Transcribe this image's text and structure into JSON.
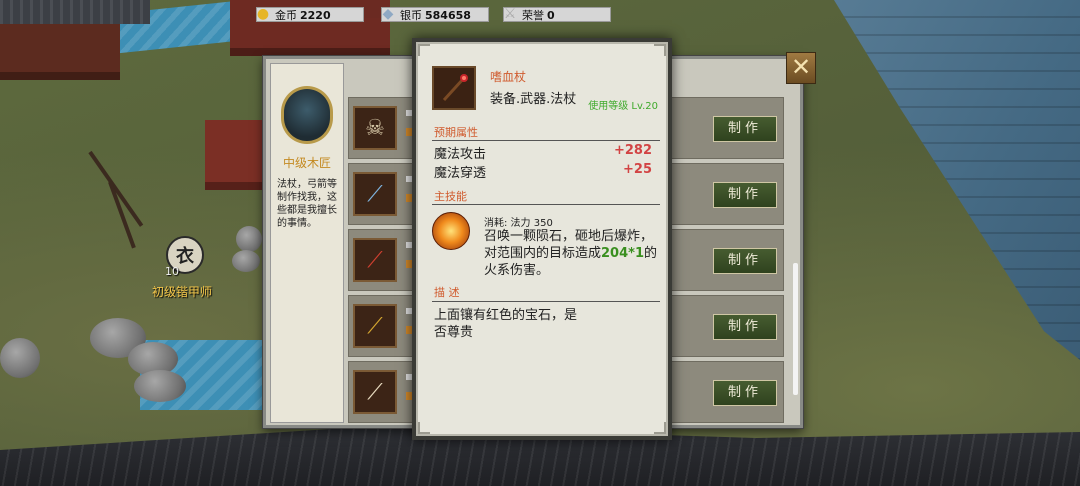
{
  "currency": {
    "gold_label": "金币",
    "gold_value": "2220",
    "silver_label": "银币",
    "silver_value": "584658",
    "honor_label": "荣誉",
    "honor_value": "0"
  },
  "npc": {
    "badge": "衣",
    "level": "10",
    "name": "初级锴甲师"
  },
  "craftsman": {
    "title": "中级木匠",
    "description": "法杖，弓箭等\n制作找我，这\n些都是我擅长\n的事情。"
  },
  "craft_list": {
    "button_label": "制作",
    "items": [
      {
        "icon": "skull-book-icon"
      },
      {
        "icon": "blue-orb-staff-icon"
      },
      {
        "icon": "red-gem-staff-icon"
      },
      {
        "icon": "golden-staff-icon"
      },
      {
        "icon": "scroll-staff-icon"
      }
    ]
  },
  "item_detail": {
    "name": "嗜血杖",
    "type": "装备.武器.法杖",
    "required_level": "使用等级 Lv.20",
    "attributes_title": "预期属性",
    "attributes": [
      {
        "name": "魔法攻击",
        "value": "+282"
      },
      {
        "name": "魔法穿透",
        "value": "+25"
      }
    ],
    "skill_title": "主技能",
    "skill_cost": "消耗: 法力 350",
    "skill_desc_part1": "召唤一颗陨石，砸地后爆炸，对范围内的目标造成",
    "skill_damage": "204*1",
    "skill_desc_part2": "的火系伤害。",
    "description_title": "描 述",
    "description": "上面镶有红色的宝石，是\n否尊贵"
  },
  "colors": {
    "accent_red": "#d05b2e",
    "level_green": "#3faa2c",
    "stat_red": "#d24444",
    "button_green": "#3a4f26"
  }
}
